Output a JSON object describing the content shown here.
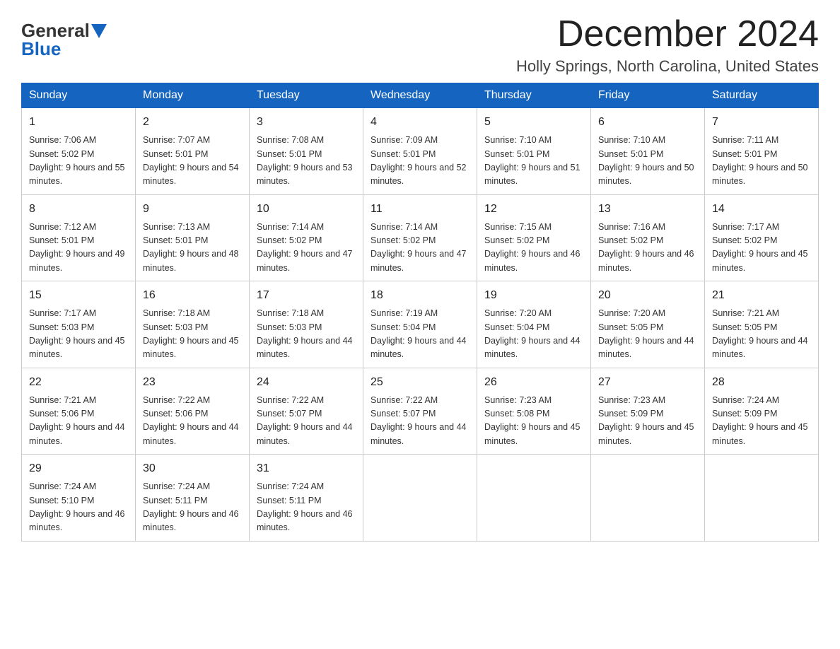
{
  "header": {
    "logo_general": "General",
    "logo_blue": "Blue",
    "month_title": "December 2024",
    "location": "Holly Springs, North Carolina, United States"
  },
  "weekdays": [
    "Sunday",
    "Monday",
    "Tuesday",
    "Wednesday",
    "Thursday",
    "Friday",
    "Saturday"
  ],
  "weeks": [
    [
      {
        "day": "1",
        "sunrise": "7:06 AM",
        "sunset": "5:02 PM",
        "daylight": "9 hours and 55 minutes."
      },
      {
        "day": "2",
        "sunrise": "7:07 AM",
        "sunset": "5:01 PM",
        "daylight": "9 hours and 54 minutes."
      },
      {
        "day": "3",
        "sunrise": "7:08 AM",
        "sunset": "5:01 PM",
        "daylight": "9 hours and 53 minutes."
      },
      {
        "day": "4",
        "sunrise": "7:09 AM",
        "sunset": "5:01 PM",
        "daylight": "9 hours and 52 minutes."
      },
      {
        "day": "5",
        "sunrise": "7:10 AM",
        "sunset": "5:01 PM",
        "daylight": "9 hours and 51 minutes."
      },
      {
        "day": "6",
        "sunrise": "7:10 AM",
        "sunset": "5:01 PM",
        "daylight": "9 hours and 50 minutes."
      },
      {
        "day": "7",
        "sunrise": "7:11 AM",
        "sunset": "5:01 PM",
        "daylight": "9 hours and 50 minutes."
      }
    ],
    [
      {
        "day": "8",
        "sunrise": "7:12 AM",
        "sunset": "5:01 PM",
        "daylight": "9 hours and 49 minutes."
      },
      {
        "day": "9",
        "sunrise": "7:13 AM",
        "sunset": "5:01 PM",
        "daylight": "9 hours and 48 minutes."
      },
      {
        "day": "10",
        "sunrise": "7:14 AM",
        "sunset": "5:02 PM",
        "daylight": "9 hours and 47 minutes."
      },
      {
        "day": "11",
        "sunrise": "7:14 AM",
        "sunset": "5:02 PM",
        "daylight": "9 hours and 47 minutes."
      },
      {
        "day": "12",
        "sunrise": "7:15 AM",
        "sunset": "5:02 PM",
        "daylight": "9 hours and 46 minutes."
      },
      {
        "day": "13",
        "sunrise": "7:16 AM",
        "sunset": "5:02 PM",
        "daylight": "9 hours and 46 minutes."
      },
      {
        "day": "14",
        "sunrise": "7:17 AM",
        "sunset": "5:02 PM",
        "daylight": "9 hours and 45 minutes."
      }
    ],
    [
      {
        "day": "15",
        "sunrise": "7:17 AM",
        "sunset": "5:03 PM",
        "daylight": "9 hours and 45 minutes."
      },
      {
        "day": "16",
        "sunrise": "7:18 AM",
        "sunset": "5:03 PM",
        "daylight": "9 hours and 45 minutes."
      },
      {
        "day": "17",
        "sunrise": "7:18 AM",
        "sunset": "5:03 PM",
        "daylight": "9 hours and 44 minutes."
      },
      {
        "day": "18",
        "sunrise": "7:19 AM",
        "sunset": "5:04 PM",
        "daylight": "9 hours and 44 minutes."
      },
      {
        "day": "19",
        "sunrise": "7:20 AM",
        "sunset": "5:04 PM",
        "daylight": "9 hours and 44 minutes."
      },
      {
        "day": "20",
        "sunrise": "7:20 AM",
        "sunset": "5:05 PM",
        "daylight": "9 hours and 44 minutes."
      },
      {
        "day": "21",
        "sunrise": "7:21 AM",
        "sunset": "5:05 PM",
        "daylight": "9 hours and 44 minutes."
      }
    ],
    [
      {
        "day": "22",
        "sunrise": "7:21 AM",
        "sunset": "5:06 PM",
        "daylight": "9 hours and 44 minutes."
      },
      {
        "day": "23",
        "sunrise": "7:22 AM",
        "sunset": "5:06 PM",
        "daylight": "9 hours and 44 minutes."
      },
      {
        "day": "24",
        "sunrise": "7:22 AM",
        "sunset": "5:07 PM",
        "daylight": "9 hours and 44 minutes."
      },
      {
        "day": "25",
        "sunrise": "7:22 AM",
        "sunset": "5:07 PM",
        "daylight": "9 hours and 44 minutes."
      },
      {
        "day": "26",
        "sunrise": "7:23 AM",
        "sunset": "5:08 PM",
        "daylight": "9 hours and 45 minutes."
      },
      {
        "day": "27",
        "sunrise": "7:23 AM",
        "sunset": "5:09 PM",
        "daylight": "9 hours and 45 minutes."
      },
      {
        "day": "28",
        "sunrise": "7:24 AM",
        "sunset": "5:09 PM",
        "daylight": "9 hours and 45 minutes."
      }
    ],
    [
      {
        "day": "29",
        "sunrise": "7:24 AM",
        "sunset": "5:10 PM",
        "daylight": "9 hours and 46 minutes."
      },
      {
        "day": "30",
        "sunrise": "7:24 AM",
        "sunset": "5:11 PM",
        "daylight": "9 hours and 46 minutes."
      },
      {
        "day": "31",
        "sunrise": "7:24 AM",
        "sunset": "5:11 PM",
        "daylight": "9 hours and 46 minutes."
      },
      null,
      null,
      null,
      null
    ]
  ]
}
